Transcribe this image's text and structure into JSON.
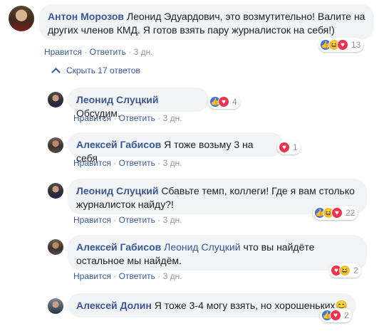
{
  "colors": {
    "link": "#385898",
    "muted": "#90949c",
    "bubble": "#f2f3f5",
    "like": "#3b74e8",
    "love": "#f0314e",
    "haha": "#f7c12f"
  },
  "actions": {
    "like": "Нравится",
    "reply": "Ответить",
    "sep": " · "
  },
  "comment": {
    "author": "Антон Морозов",
    "text": "Леонид Эдуардович, это возмутительно! Валите на других членов КМД. Я готов взять пару журналисток на себя!)",
    "time": "3 дн.",
    "reactions": [
      "like",
      "haha",
      "love"
    ],
    "reaction_count": "13"
  },
  "hide_replies_label": "Скрыть 17 ответов",
  "replies": [
    {
      "author": "Леонид Слуцкий",
      "text": "Обсудим.",
      "time": "3 дн.",
      "reactions": [
        "like",
        "love"
      ],
      "reaction_count": "4"
    },
    {
      "author": "Алексей Габисов",
      "text": "Я тоже возьму 3 на себя",
      "time": "3 дн.",
      "reactions": [
        "love"
      ],
      "reaction_count": "1"
    },
    {
      "author": "Леонид Слуцкий",
      "text": "Сбавьте темп, коллеги! Где я вам столько журналисток найду?!",
      "time": "3 дн.",
      "reactions": [
        "like",
        "haha",
        "love"
      ],
      "reaction_count": "22"
    },
    {
      "author": "Алексей Габисов",
      "mention": "Леонид Слуцкий",
      "text": "что вы найдёте остальное мы найдём.",
      "time": "3 дн.",
      "reactions": [
        "love",
        "haha"
      ],
      "reaction_count": "2"
    },
    {
      "author": "Алексей Долин",
      "text": "Я тоже 3-4 могу взять, но хорошеньких",
      "emoji": "😊",
      "reactions": [
        "like",
        "love"
      ],
      "reaction_count": "2"
    }
  ]
}
